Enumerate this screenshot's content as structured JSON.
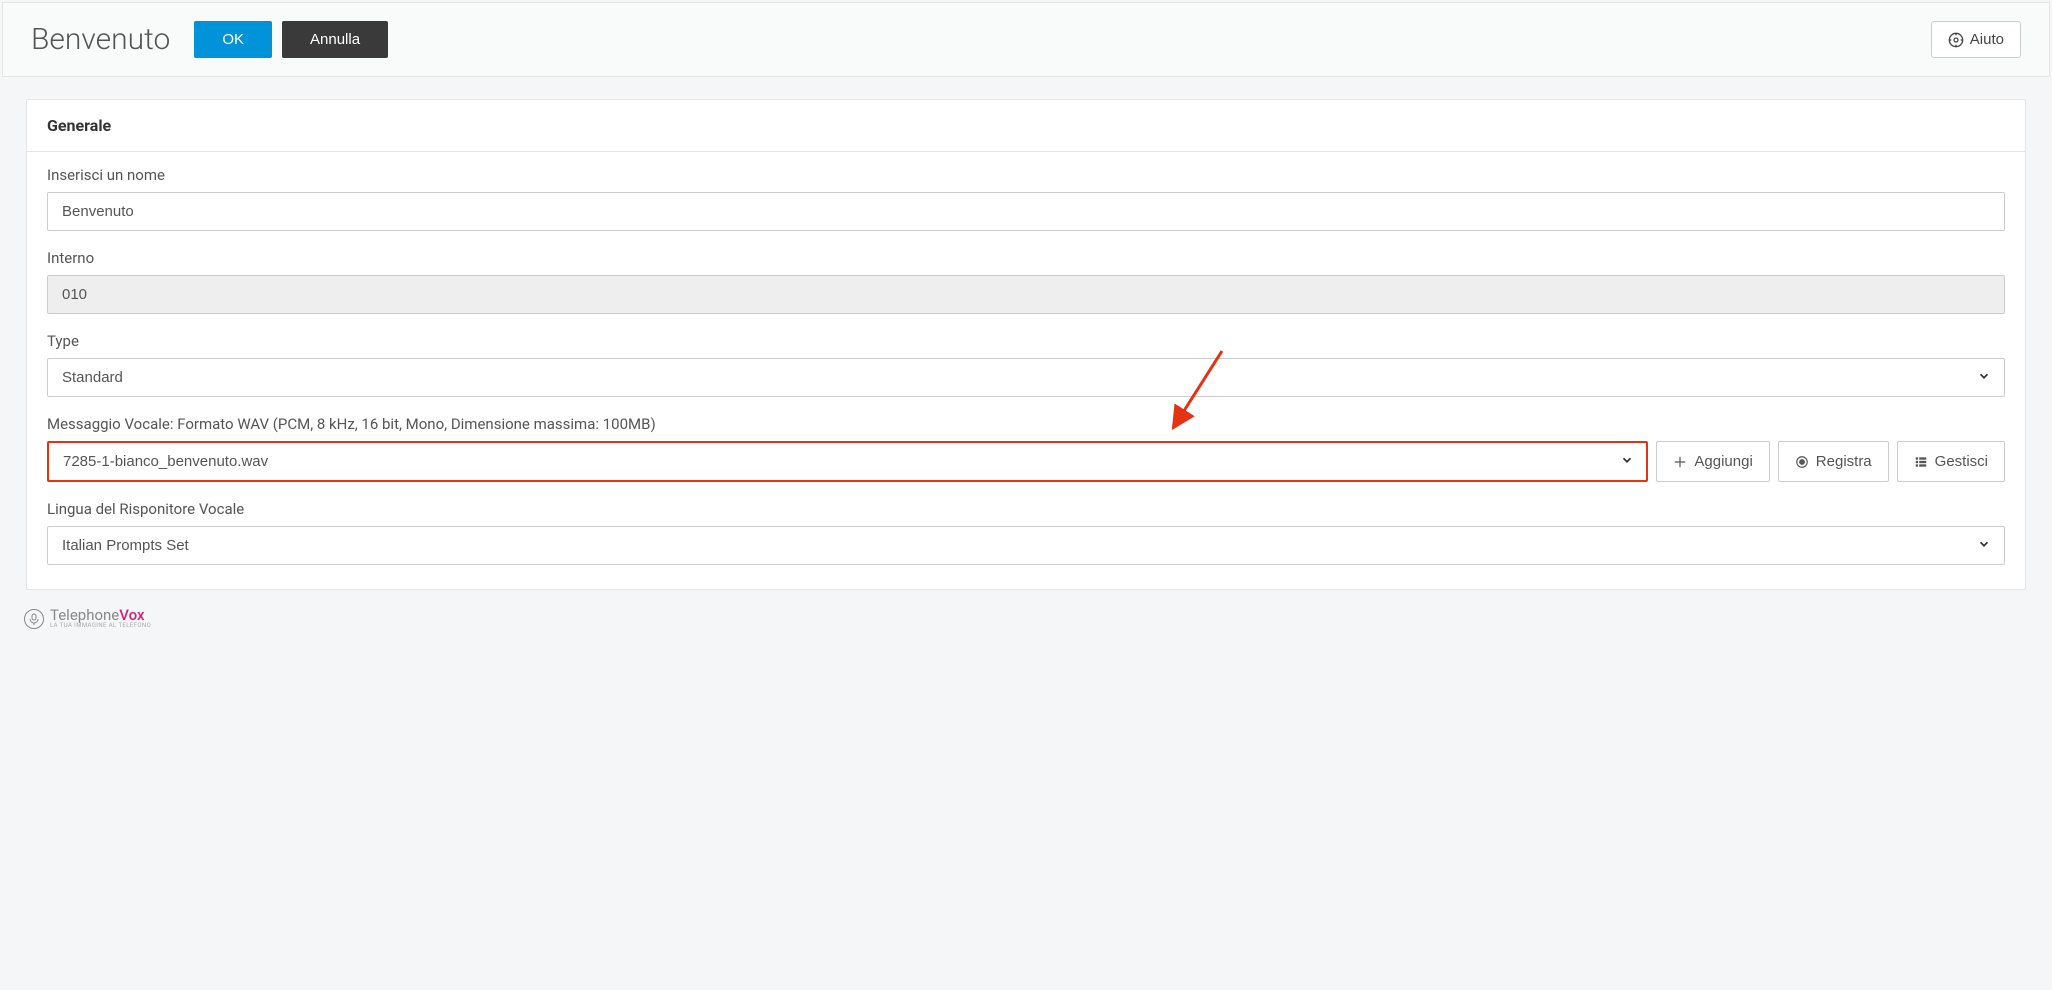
{
  "header": {
    "title": "Benvenuto",
    "ok_label": "OK",
    "cancel_label": "Annulla",
    "help_label": "Aiuto"
  },
  "section": {
    "title": "Generale"
  },
  "form": {
    "name_label": "Inserisci un nome",
    "name_value": "Benvenuto",
    "interno_label": "Interno",
    "interno_value": "010",
    "type_label": "Type",
    "type_value": "Standard",
    "voice_label": "Messaggio Vocale: Formato WAV (PCM, 8 kHz, 16 bit, Mono, Dimensione massima: 100MB)",
    "voice_value": "7285-1-bianco_benvenuto.wav",
    "add_label": "Aggiungi",
    "record_label": "Registra",
    "manage_label": "Gestisci",
    "lang_label": "Lingua del Risponitore Vocale",
    "lang_value": "Italian Prompts Set"
  },
  "footer": {
    "brand_prefix": "Telephone",
    "brand_accent": "Vox",
    "brand_sub": "LA TUA IMMAGINE AL TELEFONO"
  }
}
